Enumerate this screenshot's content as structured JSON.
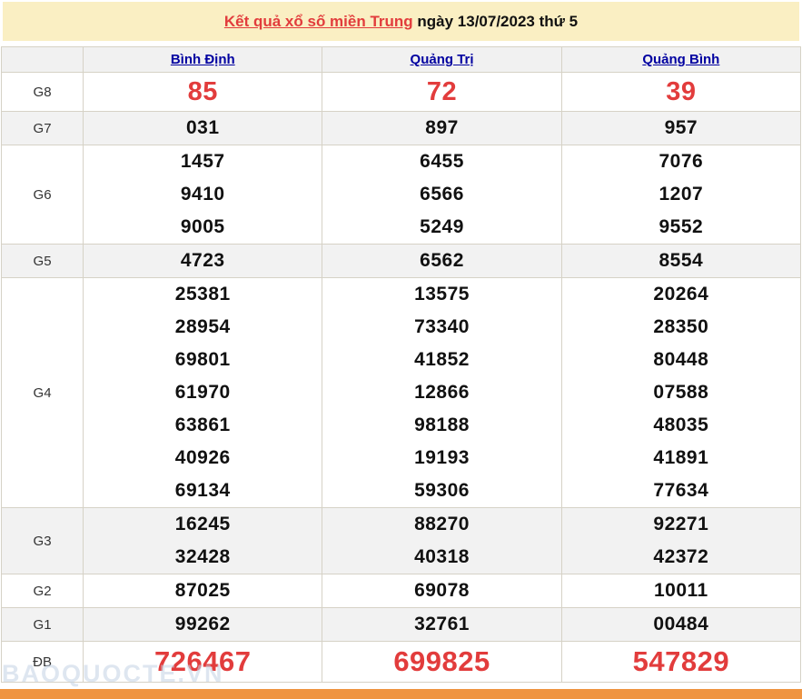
{
  "title": {
    "link": "Kết quả xổ số miền Trung",
    "suffix": " ngày 13/07/2023 thứ 5"
  },
  "table": {
    "columns": [
      "Bình Định",
      "Quảng Trị",
      "Quảng Bình"
    ],
    "rows": [
      {
        "label": "G8",
        "style": "red-large",
        "values": [
          [
            "85"
          ],
          [
            "72"
          ],
          [
            "39"
          ]
        ]
      },
      {
        "label": "G7",
        "style": "",
        "values": [
          [
            "031"
          ],
          [
            "897"
          ],
          [
            "957"
          ]
        ]
      },
      {
        "label": "G6",
        "style": "",
        "values": [
          [
            "1457",
            "9410",
            "9005"
          ],
          [
            "6455",
            "6566",
            "5249"
          ],
          [
            "7076",
            "1207",
            "9552"
          ]
        ]
      },
      {
        "label": "G5",
        "style": "",
        "values": [
          [
            "4723"
          ],
          [
            "6562"
          ],
          [
            "8554"
          ]
        ]
      },
      {
        "label": "G4",
        "style": "",
        "values": [
          [
            "25381",
            "28954",
            "69801",
            "61970",
            "63861",
            "40926",
            "69134"
          ],
          [
            "13575",
            "73340",
            "41852",
            "12866",
            "98188",
            "19193",
            "59306"
          ],
          [
            "20264",
            "28350",
            "80448",
            "07588",
            "48035",
            "41891",
            "77634"
          ]
        ]
      },
      {
        "label": "G3",
        "style": "",
        "values": [
          [
            "16245",
            "32428"
          ],
          [
            "88270",
            "40318"
          ],
          [
            "92271",
            "42372"
          ]
        ]
      },
      {
        "label": "G2",
        "style": "",
        "values": [
          [
            "87025"
          ],
          [
            "69078"
          ],
          [
            "10011"
          ]
        ]
      },
      {
        "label": "G1",
        "style": "",
        "values": [
          [
            "99262"
          ],
          [
            "32761"
          ],
          [
            "00484"
          ]
        ]
      },
      {
        "label": "ĐB",
        "style": "red-xlarge",
        "values": [
          [
            "726467"
          ],
          [
            "699825"
          ],
          [
            "547829"
          ]
        ]
      }
    ]
  },
  "watermark": "BAOQUOCTE.VN",
  "colors": {
    "banner_bg": "#faefc3",
    "accent_red": "#e23c3c",
    "link_blue": "#0000a0",
    "stripe_gray": "#f2f2f2",
    "border": "#d6d2c6",
    "bottom_bar_orange": "#ef9441"
  }
}
